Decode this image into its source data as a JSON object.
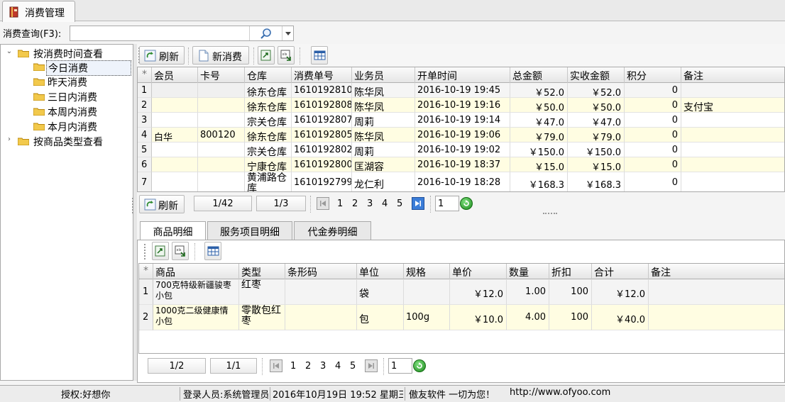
{
  "window": {
    "tab_title": "消费管理"
  },
  "search": {
    "label": "消费查询(F3):",
    "value": "",
    "placeholder": ""
  },
  "tree": {
    "root1": "按消费时间查看",
    "children": [
      "今日消费",
      "昨天消费",
      "三日内消费",
      "本周内消费",
      "本月内消费"
    ],
    "selected": "今日消费",
    "root2": "按商品类型查看"
  },
  "toolbar_main": {
    "refresh": "刷新",
    "new": "新消费"
  },
  "orders": {
    "columns": [
      "会员",
      "卡号",
      "仓库",
      "消费单号",
      "业务员",
      "开单时间",
      "总金额",
      "实收金额",
      "积分",
      "备注"
    ],
    "rows": [
      {
        "n": "1",
        "member": "",
        "card": "",
        "store": "徐东仓库",
        "no": "1610192810",
        "staff": "陈华凤",
        "time": "2016-10-19 19:45",
        "total": "￥52.0",
        "paid": "￥52.0",
        "points": "0",
        "note": ""
      },
      {
        "n": "2",
        "member": "",
        "card": "",
        "store": "徐东仓库",
        "no": "1610192808",
        "staff": "陈华凤",
        "time": "2016-10-19 19:16",
        "total": "￥50.0",
        "paid": "￥50.0",
        "points": "0",
        "note": "支付宝"
      },
      {
        "n": "3",
        "member": "",
        "card": "",
        "store": "宗关仓库",
        "no": "1610192807",
        "staff": "周莉",
        "time": "2016-10-19 19:14",
        "total": "￥47.0",
        "paid": "￥47.0",
        "points": "0",
        "note": ""
      },
      {
        "n": "4",
        "member": "白华",
        "card": "800120",
        "store": "徐东仓库",
        "no": "1610192805",
        "staff": "陈华凤",
        "time": "2016-10-19 19:06",
        "total": "￥79.0",
        "paid": "￥79.0",
        "points": "0",
        "note": ""
      },
      {
        "n": "5",
        "member": "",
        "card": "",
        "store": "宗关仓库",
        "no": "1610192802",
        "staff": "周莉",
        "time": "2016-10-19 19:02",
        "total": "￥150.0",
        "paid": "￥150.0",
        "points": "0",
        "note": ""
      },
      {
        "n": "6",
        "member": "",
        "card": "",
        "store": "宁康仓库",
        "no": "1610192800",
        "staff": "匡湖容",
        "time": "2016-10-19 18:37",
        "total": "￥15.0",
        "paid": "￥15.0",
        "points": "0",
        "note": ""
      },
      {
        "n": "7",
        "member": "",
        "card": "",
        "store": "黄浦路仓库",
        "no": "1610192799",
        "staff": "龙仁利",
        "time": "2016-10-19 18:28",
        "total": "￥168.3",
        "paid": "￥168.3",
        "points": "0",
        "note": ""
      }
    ]
  },
  "pager_main": {
    "refresh": "刷新",
    "records": "1/42",
    "pages": "1/3",
    "page_numbers": [
      "1",
      "2",
      "3",
      "4",
      "5"
    ],
    "goto_value": "1"
  },
  "detail_tabs": [
    "商品明细",
    "服务项目明细",
    "代金券明细"
  ],
  "items": {
    "columns": [
      "商品",
      "类型",
      "条形码",
      "单位",
      "规格",
      "单价",
      "数量",
      "折扣",
      "合计",
      "备注"
    ],
    "rows": [
      {
        "n": "1",
        "product": "700克特级新疆骏枣小包",
        "type": "红枣",
        "barcode": "",
        "unit": "袋",
        "spec": "",
        "price": "￥12.0",
        "qty": "1.00",
        "discount": "100",
        "sum": "￥12.0",
        "note": ""
      },
      {
        "n": "2",
        "product": "1000克二级健康情小包",
        "type": "零散包红枣",
        "barcode": "",
        "unit": "包",
        "spec": "100g",
        "price": "￥10.0",
        "qty": "4.00",
        "discount": "100",
        "sum": "￥40.0",
        "note": ""
      }
    ]
  },
  "pager_detail": {
    "records": "1/2",
    "pages": "1/1",
    "page_numbers": [
      "1",
      "2",
      "3",
      "4",
      "5"
    ],
    "goto_value": "1"
  },
  "status": {
    "license": "授权:好想你",
    "user": "登录人员:系统管理员",
    "datetime": "2016年10月19日 19:52 星期三",
    "slogan": "傲友软件 一切为您！",
    "url": "http://www.ofyoo.com"
  }
}
